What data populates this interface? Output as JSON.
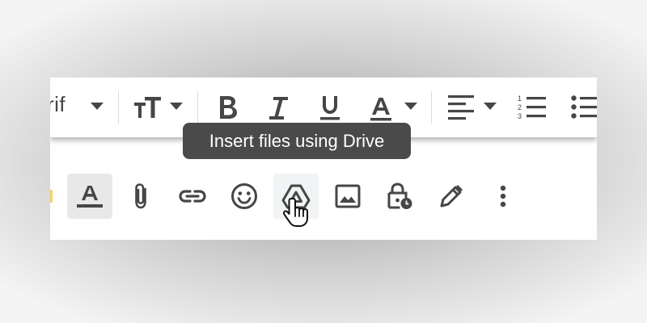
{
  "format_toolbar": {
    "font_name_fragment": "rif",
    "items": [
      "font-dropdown",
      "text-size",
      "bold",
      "italic",
      "underline",
      "text-color",
      "align",
      "numbered-list",
      "bulleted-list"
    ]
  },
  "tooltip": {
    "text": "Insert files using Drive"
  },
  "compose_toolbar": {
    "items": [
      "formatting-options",
      "attach-files",
      "insert-link",
      "insert-emoji",
      "insert-files-using-drive",
      "insert-photo",
      "confidential-mode",
      "insert-signature",
      "more-options"
    ],
    "active": "formatting-options",
    "hovered": "insert-files-using-drive"
  },
  "colors": {
    "icon": "#444746",
    "tooltip_bg": "#4a4a4a",
    "active_bg": "#e8e8e8",
    "text_color_bar": "#444746"
  }
}
